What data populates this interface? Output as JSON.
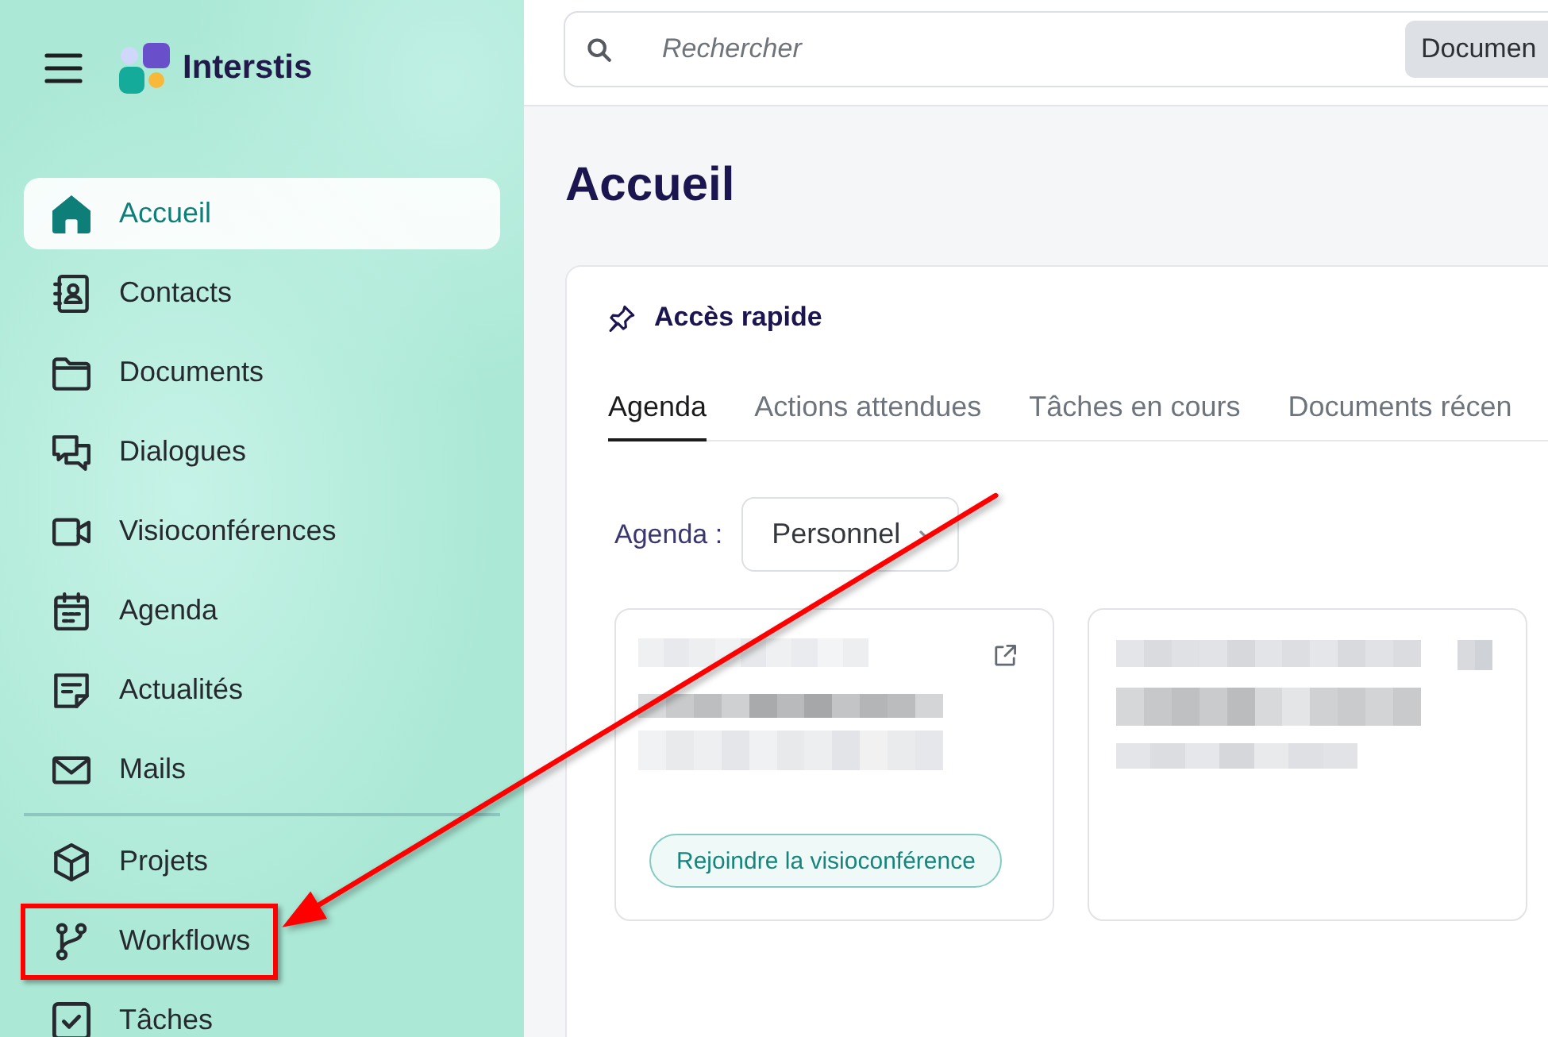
{
  "sidebar": {
    "brand": "Interstis",
    "sections": [
      {
        "items": [
          {
            "label": "Accueil",
            "selected": true,
            "highlighted": false
          },
          {
            "label": "Contacts",
            "selected": false,
            "highlighted": false
          },
          {
            "label": "Documents",
            "selected": false,
            "highlighted": false
          },
          {
            "label": "Dialogues",
            "selected": false,
            "highlighted": false
          },
          {
            "label": "Visioconférences",
            "selected": false,
            "highlighted": false
          },
          {
            "label": "Agenda",
            "selected": false,
            "highlighted": false
          },
          {
            "label": "Actualités",
            "selected": false,
            "highlighted": false
          },
          {
            "label": "Mails",
            "selected": false,
            "highlighted": false
          }
        ]
      },
      {
        "items": [
          {
            "label": "Projets",
            "selected": false,
            "highlighted": false
          },
          {
            "label": "Workflows",
            "selected": false,
            "highlighted": true
          },
          {
            "label": "Tâches",
            "selected": false,
            "highlighted": false
          }
        ]
      }
    ]
  },
  "topbar": {
    "search": {
      "placeholder": "Rechercher"
    },
    "scope_button": "Documen"
  },
  "main": {
    "title": "Accueil",
    "quick_access": {
      "title": "Accès rapide",
      "tabs": [
        {
          "label": "Agenda",
          "selected": true
        },
        {
          "label": "Actions attendues",
          "selected": false
        },
        {
          "label": "Tâches en cours",
          "selected": false
        },
        {
          "label": "Documents récen",
          "selected": false
        }
      ],
      "agenda_filter": {
        "label": "Agenda :",
        "value": "Personnel"
      },
      "events": [
        {
          "kind": "visio",
          "action": "Rejoindre la visioconférence"
        },
        {
          "kind": "plain"
        }
      ]
    }
  }
}
